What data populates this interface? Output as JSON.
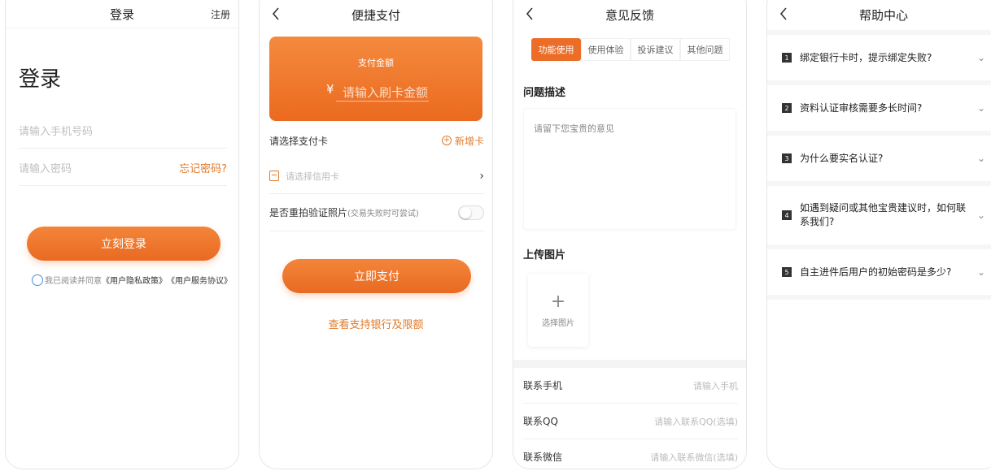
{
  "login": {
    "header_title": "登录",
    "register_label": "注册",
    "big_title": "登录",
    "phone_placeholder": "请输入手机号码",
    "password_placeholder": "请输入密码",
    "forgot_label": "忘记密码?",
    "login_button": "立刻登录",
    "agree_prefix": "我已阅读并同意",
    "privacy_doc": "《用户隐私政策》",
    "service_doc": "《用户服务协议》"
  },
  "quickpay": {
    "header_title": "便捷支付",
    "amount_label": "支付金额",
    "currency_symbol": "¥",
    "amount_placeholder": "请输入刷卡金额",
    "select_card_label": "请选择支付卡",
    "add_card_label": "新增卡",
    "credit_card_placeholder": "请选择信用卡",
    "retake_label": "是否重拍验证照片",
    "retake_hint": "(交易失败时可尝试)",
    "pay_button": "立即支付",
    "view_banks_link": "查看支持银行及限额"
  },
  "feedback": {
    "header_title": "意见反馈",
    "tabs": [
      "功能使用",
      "使用体验",
      "投诉建议",
      "其他问题"
    ],
    "active_tab": 0,
    "desc_title": "问题描述",
    "desc_placeholder": "请留下您宝贵的意见",
    "upload_title": "上传图片",
    "upload_label": "选择图片",
    "contacts": [
      {
        "label": "联系手机",
        "placeholder": "请输入手机"
      },
      {
        "label": "联系QQ",
        "placeholder": "请输入联系QQ(选填)"
      },
      {
        "label": "联系微信",
        "placeholder": "请输入联系微信(选填)"
      }
    ]
  },
  "help": {
    "header_title": "帮助中心",
    "faqs": [
      {
        "num": "1",
        "question": "绑定银行卡时，提示绑定失败?"
      },
      {
        "num": "2",
        "question": "资料认证审核需要多长时间?"
      },
      {
        "num": "3",
        "question": "为什么要实名认证?"
      },
      {
        "num": "4",
        "question": "如遇到疑问或其他宝贵建议时，如何联系我们?"
      },
      {
        "num": "5",
        "question": "自主进件后用户的初始密码是多少?"
      }
    ]
  },
  "colors": {
    "accent": "#ec6d27",
    "link": "#e07a2b"
  }
}
